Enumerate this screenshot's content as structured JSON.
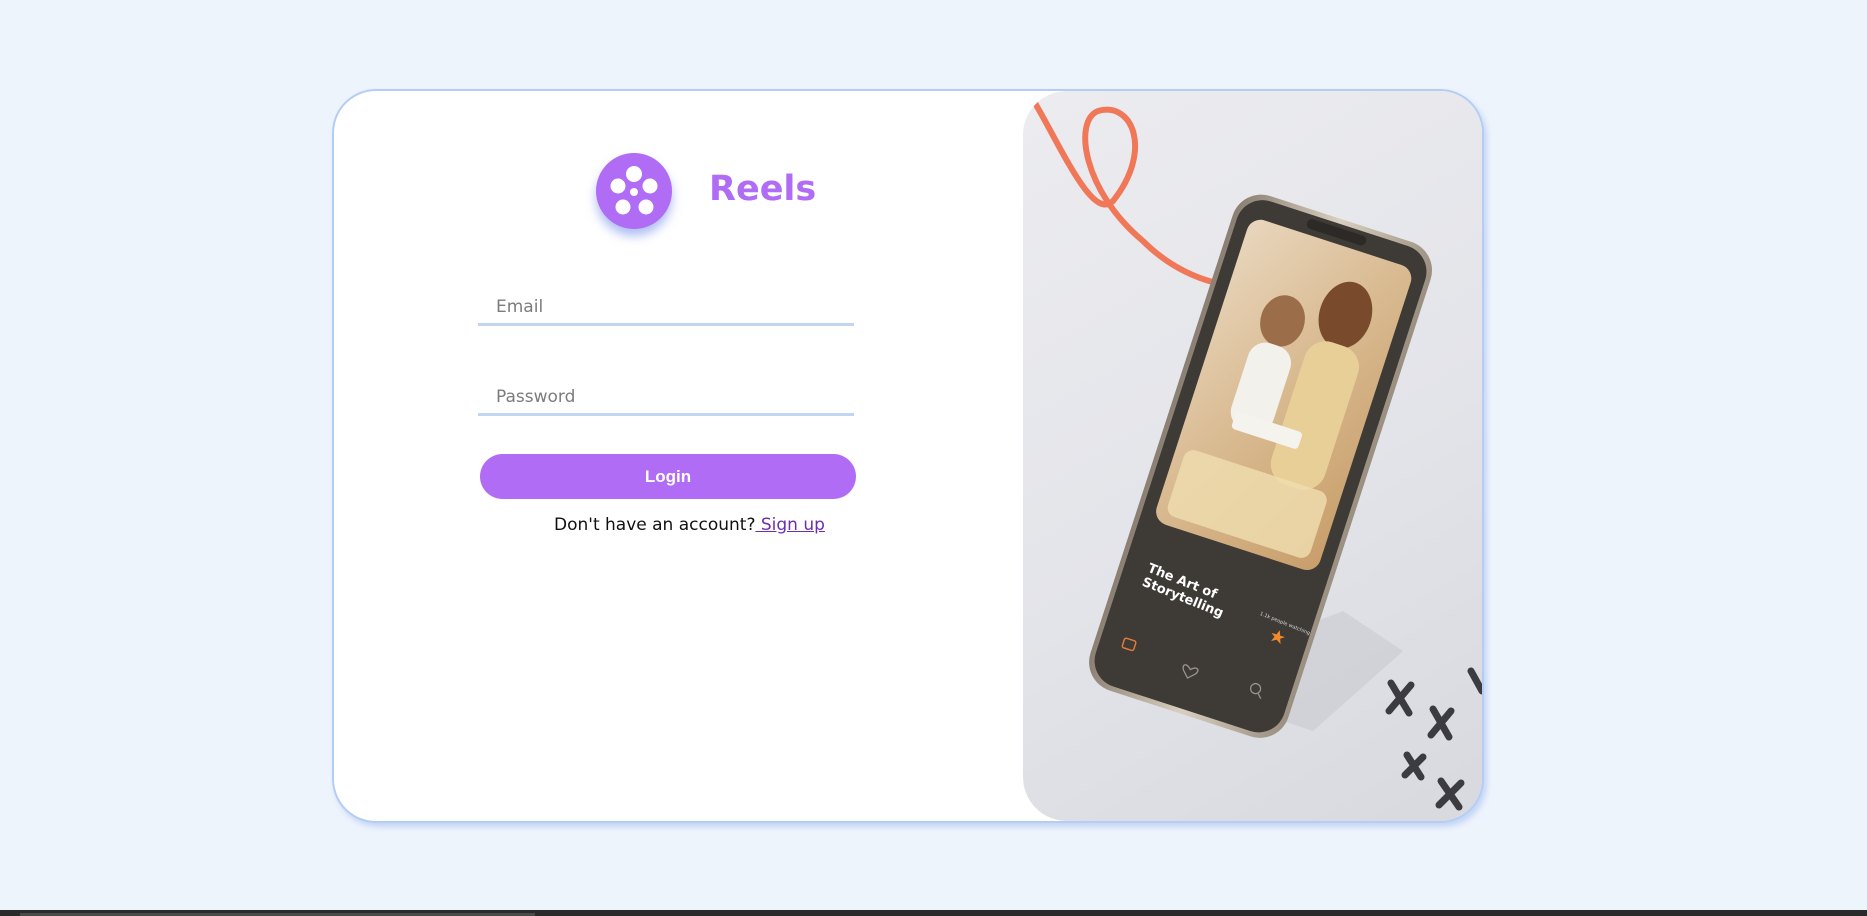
{
  "brand": {
    "name": "Reels",
    "icon": "film-reel-icon",
    "accent_color": "#b06cf5"
  },
  "login_form": {
    "email_placeholder": "Email",
    "email_value": "",
    "password_placeholder": "Password",
    "password_value": "",
    "login_label": "Login"
  },
  "signup": {
    "prompt": "Don't have an account?",
    "link_label": " Sign up"
  },
  "promo_image": {
    "caption": "The Art of Storytelling",
    "watching": "1.1k people watching"
  },
  "colors": {
    "background": "#eef4fc",
    "card_border": "#b5ccf5",
    "field_underline": "#c2d6f2",
    "link": "#6a2fb0",
    "ribbon": "#f07858"
  }
}
